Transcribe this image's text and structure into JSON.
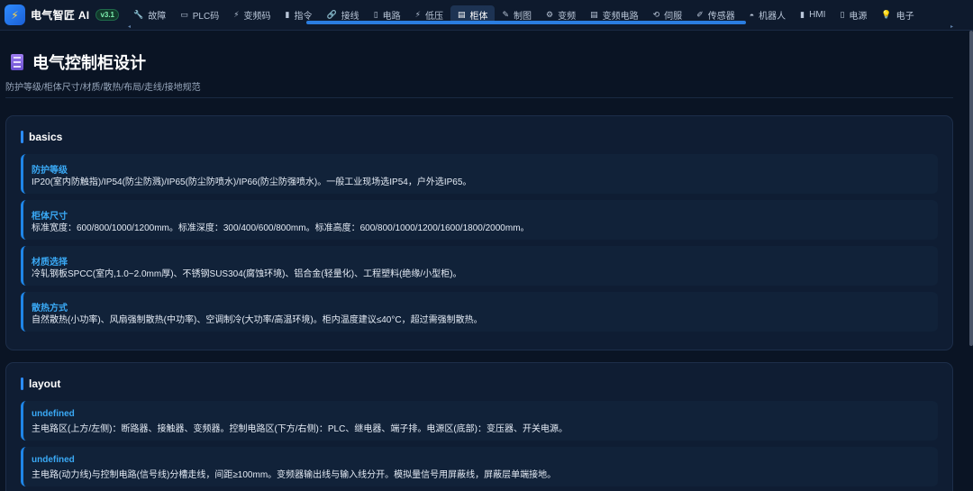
{
  "app": {
    "icon": "bolt-icon",
    "name": "电气智匠 AI",
    "version": "v3.1"
  },
  "tabs": [
    {
      "icon": "wrench-icon",
      "glyph": "🔧",
      "label": "故障"
    },
    {
      "icon": "plc-icon",
      "glyph": "▭",
      "label": "PLC码"
    },
    {
      "icon": "lightning-icon",
      "glyph": "⚡",
      "label": "变频码"
    },
    {
      "icon": "command-icon",
      "glyph": "▮",
      "label": "指令"
    },
    {
      "icon": "link-icon",
      "glyph": "🔗",
      "label": "接线"
    },
    {
      "icon": "circuit-icon",
      "glyph": "▯",
      "label": "电路"
    },
    {
      "icon": "low-voltage-icon",
      "glyph": "⚡",
      "label": "低压"
    },
    {
      "icon": "cabinet-icon",
      "glyph": "▤",
      "label": "柜体"
    },
    {
      "icon": "pencil-icon",
      "glyph": "✎",
      "label": "制图"
    },
    {
      "icon": "gear-icon",
      "glyph": "⚙",
      "label": "变频"
    },
    {
      "icon": "document-icon",
      "glyph": "▤",
      "label": "变频电路"
    },
    {
      "icon": "servo-icon",
      "glyph": "⟲",
      "label": "伺服"
    },
    {
      "icon": "sensor-icon",
      "glyph": "✐",
      "label": "传感器"
    },
    {
      "icon": "robot-icon",
      "glyph": "◓",
      "label": "机器人"
    },
    {
      "icon": "hmi-icon",
      "glyph": "▮",
      "label": "HMI"
    },
    {
      "icon": "power-icon",
      "glyph": "▯",
      "label": "电源"
    },
    {
      "icon": "bulb-icon",
      "glyph": "💡",
      "label": "电子"
    }
  ],
  "active_tab": "柜体",
  "page": {
    "icon": "cabinet-icon",
    "title": "电气控制柜设计",
    "subtitle": "防护等级/柜体尺寸/材质/散热/布局/走线/接地规范"
  },
  "sections": {
    "basics": {
      "title": "basics",
      "items": [
        {
          "title": "防护等级",
          "text": "IP20(室内防触指)/IP54(防尘防溅)/IP65(防尘防喷水)/IP66(防尘防强喷水)。一般工业现场选IP54，户外选IP65。"
        },
        {
          "title": "柜体尺寸",
          "text": "标准宽度：600/800/1000/1200mm。标准深度：300/400/600/800mm。标准高度：600/800/1000/1200/1600/1800/2000mm。"
        },
        {
          "title": "材质选择",
          "text": "冷轧钢板SPCC(室内,1.0~2.0mm厚)、不锈钢SUS304(腐蚀环境)、铝合金(轻量化)、工程塑料(绝缘/小型柜)。"
        },
        {
          "title": "散热方式",
          "text": "自然散热(小功率)、风扇强制散热(中功率)、空调制冷(大功率/高温环境)。柜内温度建议≤40°C，超过需强制散热。"
        }
      ]
    },
    "layout": {
      "title": "layout",
      "items": [
        {
          "title": "undefined",
          "text": "主电路区(上方/左侧)：断路器、接触器、变频器。控制电路区(下方/右侧)：PLC、继电器、端子排。电源区(底部)：变压器、开关电源。"
        },
        {
          "title": "undefined",
          "text": "主电路(动力线)与控制电路(信号线)分槽走线，间距≥100mm。变频器输出线与输入线分开。模拟量信号用屏蔽线，屏蔽层单端接地。"
        }
      ]
    }
  },
  "colors": {
    "background": "#0a1424",
    "accent": "#2b8cff",
    "item_title": "#3aa9f5",
    "version_badge": "#7ef0b0"
  }
}
